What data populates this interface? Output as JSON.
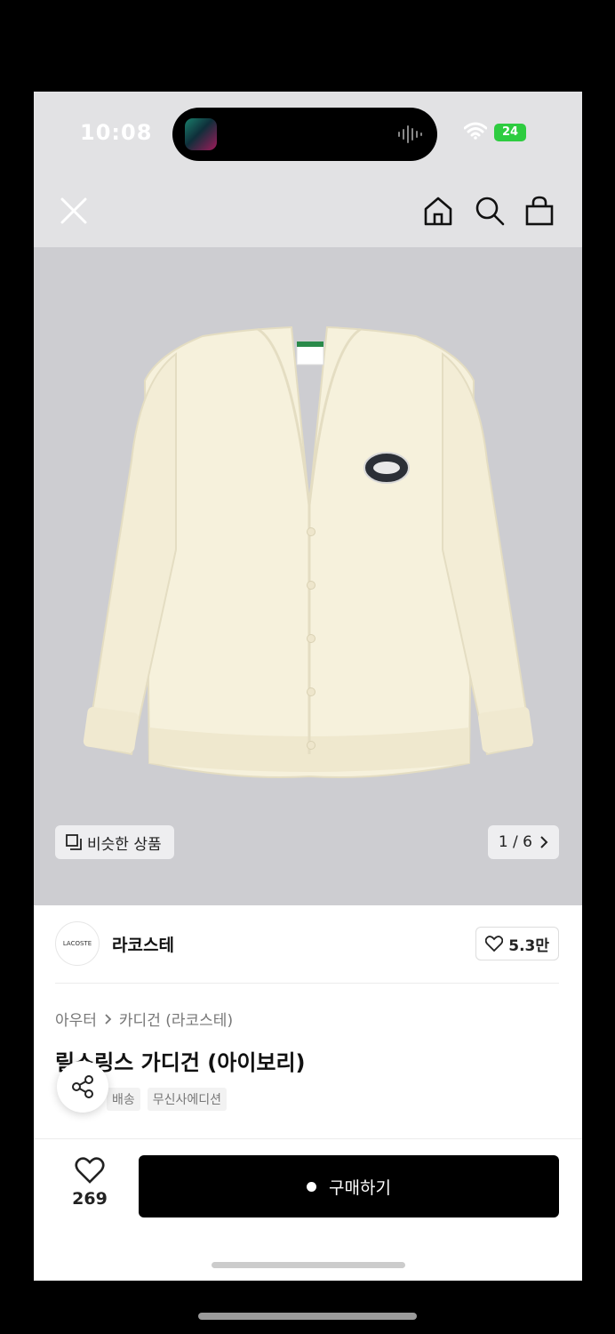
{
  "status_bar": {
    "time": "10:08",
    "battery": "24"
  },
  "nav": {
    "close": "close-icon",
    "home": "home-icon",
    "search": "search-icon",
    "bag": "shopping-bag-icon"
  },
  "gallery": {
    "similar_label": "비슷한 상품",
    "page_indicator": "1 / 6"
  },
  "brand": {
    "name": "라코스테",
    "logo_text": "LACOSTE",
    "likes": "5.3만"
  },
  "product": {
    "breadcrumb": [
      "아우터",
      "카디건 (라코스테)"
    ],
    "title": "릴스링스 가디건 (아이보리)",
    "tags": [
      "배송",
      "무신사에디션"
    ]
  },
  "bottom_bar": {
    "favorite_count": "269",
    "buy_label": "구매하기"
  },
  "colors": {
    "accent": "#000000",
    "battery": "#2ecc40",
    "hero_bg": "#cdcdd1",
    "garment": "#f6f1dc"
  }
}
